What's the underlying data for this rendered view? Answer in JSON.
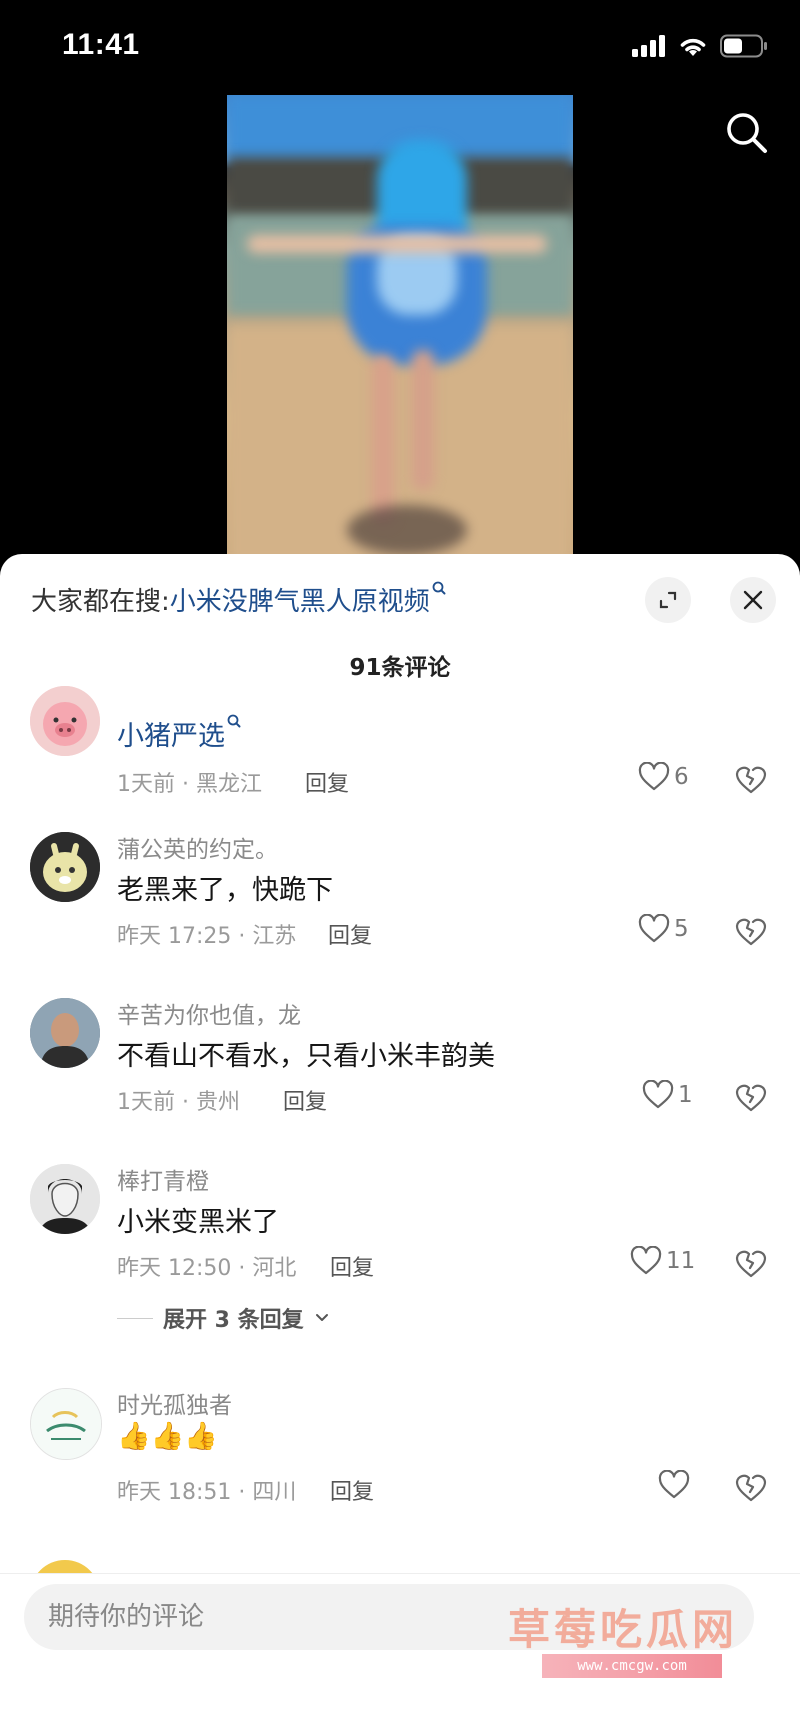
{
  "status_bar": {
    "time": "11:41"
  },
  "hot_search": {
    "prefix": "大家都在搜:",
    "query": "小米没脾气黑人原视频"
  },
  "comment_count": "91条评论",
  "comments": [
    {
      "name": "小猪严选",
      "name_style": "blue",
      "text": "",
      "time": "1天前 · 黑龙江",
      "reply": "回复",
      "likes": "6"
    },
    {
      "name": "蒲公英的约定。",
      "text": "老黑来了，快跪下",
      "time": "昨天 17:25 · 江苏",
      "reply": "回复",
      "likes": "5"
    },
    {
      "name": "辛苦为你也值，龙",
      "text": "不看山不看水，只看小米丰韵美",
      "time": "1天前 · 贵州",
      "reply": "回复",
      "likes": "1"
    },
    {
      "name": "棒打青橙",
      "text": "小米变黑米了",
      "time": "昨天 12:50 · 河北",
      "reply": "回复",
      "likes": "11",
      "expand": "展开 3 条回复"
    },
    {
      "name": "时光孤独者",
      "text": "👍👍👍",
      "time": "昨天 18:51 · 四川",
      "reply": "回复",
      "likes": ""
    }
  ],
  "input": {
    "placeholder": "期待你的评论"
  },
  "watermark": {
    "text": "草莓吃瓜网",
    "url": "www.cmcgw.com"
  },
  "colors": {
    "link": "#1f4e8c",
    "panel_bg": "#ffffff",
    "top_bg": "#000000"
  }
}
